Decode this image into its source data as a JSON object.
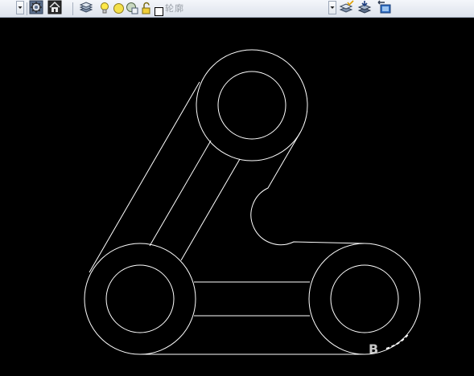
{
  "toolbar": {
    "left_dropdown_icon": "chevron-down-icon",
    "workspace_settings_icon": "gear-icon",
    "home_icon": "house-icon",
    "layer_properties_icon": "layers-icon",
    "layer_on_icon": "lightbulb-icon",
    "layer_freeze_icon": "sun-icon",
    "layer_viewport_freeze_icon": "sun-viewport-icon",
    "layer_lock_icon": "unlock-icon",
    "layer_color_swatch": "#ffffff",
    "current_layer_name": "轮廓",
    "layer_dropdown_icon": "chevron-down-icon",
    "make_current_icon": "layers-check-icon",
    "match_layer_icon": "layers-match-icon",
    "layer_previous_icon": "layers-previous-icon"
  },
  "canvas": {
    "background": "#000000",
    "stroke_color": "#ffffff",
    "ucs_label": "B"
  }
}
